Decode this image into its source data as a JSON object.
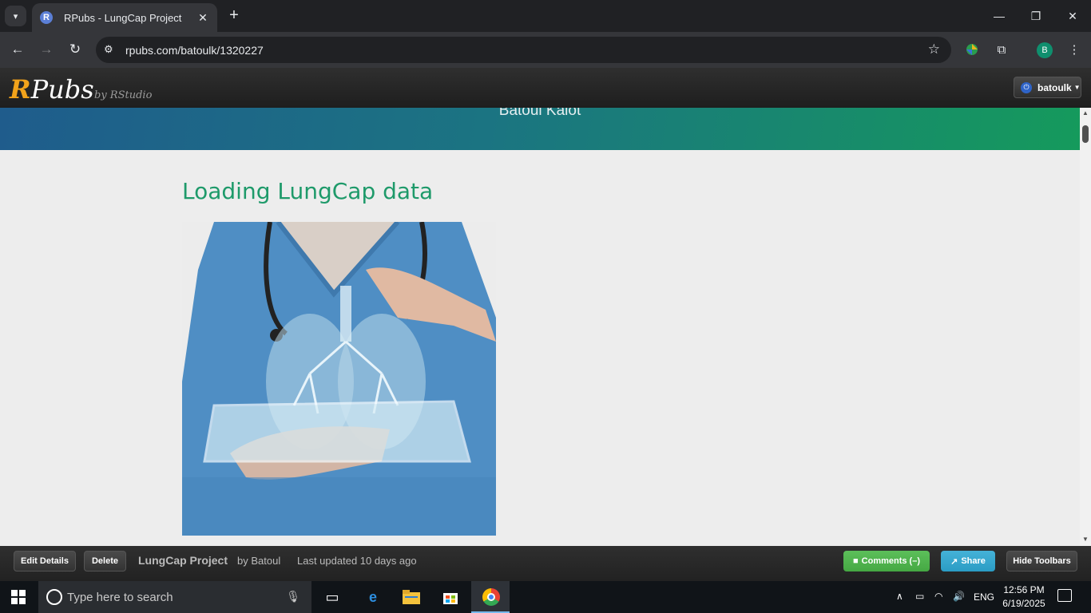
{
  "browser": {
    "tab_title": "RPubs - LungCap Project",
    "url": "rpubs.com/batoulk/1320227",
    "profile_initial": "B"
  },
  "rpubs": {
    "logo_r": "R",
    "logo_rest": "Pubs",
    "byline": "by RStudio",
    "user": "batoulk"
  },
  "page": {
    "author": "Batoul Kalot",
    "section_title": "Loading LungCap data"
  },
  "bottombar": {
    "edit_label": "Edit Details",
    "delete_label": "Delete",
    "doc_title": "LungCap Project",
    "by": "by Batoul",
    "updated": "Last updated 10 days ago",
    "comments_label": "Comments (–)",
    "share_label": "Share",
    "hide_label": "Hide Toolbars"
  },
  "taskbar": {
    "search_placeholder": "Type here to search",
    "lang": "ENG",
    "time": "12:56 PM",
    "date": "6/19/2025"
  },
  "colors": {
    "title_green": "#1e9a6a",
    "rpubs_orange": "#f2a31b",
    "comments_green": "#5cbf5a",
    "share_blue": "#45b2d8"
  }
}
